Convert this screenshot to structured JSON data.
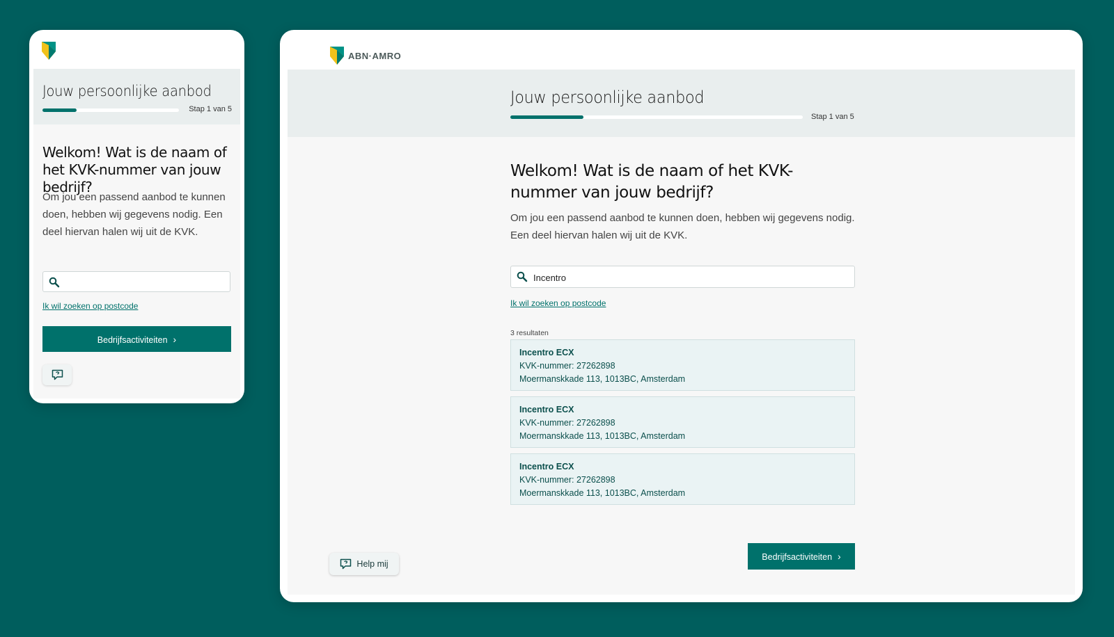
{
  "brand": {
    "name": "ABN·AMRO",
    "colors": {
      "primary": "#00716b",
      "background": "#005e5d",
      "shield_yellow": "#f1c21b",
      "shield_green": "#009286"
    }
  },
  "mobile": {
    "header": {
      "title": "Jouw persoonlijke aanbod",
      "step": "Stap 1 van 5",
      "progress": 0.25
    },
    "heading": "Welkom! Wat is de naam of het KVK-nummer van jouw bedrijf?",
    "intro": "Om jou een passend aanbod te kunnen doen, hebben wij gegevens nodig. Een deel hiervan halen wij uit de KVK.",
    "search": {
      "value": "",
      "icon": "search-icon"
    },
    "postcode_link": "Ik wil zoeken op postcode",
    "next_button": "Bedrijfsactiviteiten",
    "help_icon": "chat-help-icon"
  },
  "desktop": {
    "header": {
      "title": "Jouw persoonlijke aanbod",
      "step": "Stap 1 van 5",
      "progress": 0.25
    },
    "heading": "Welkom! Wat is de naam of het KVK-nummer van jouw bedrijf?",
    "intro": "Om jou een passend aanbod te kunnen doen, hebben wij gegevens nodig. Een deel hiervan halen wij uit de KVK.",
    "search": {
      "value": "Incentro",
      "icon": "search-icon"
    },
    "postcode_link": "Ik wil zoeken op postcode",
    "results_count": "3 resultaten",
    "results": [
      {
        "name": "Incentro ECX",
        "kvk": "KVK-nummer: 27262898",
        "address": "Moermanskkade 113, 1013BC, Amsterdam"
      },
      {
        "name": "Incentro ECX",
        "kvk": "KVK-nummer: 27262898",
        "address": "Moermanskkade 113, 1013BC, Amsterdam"
      },
      {
        "name": "Incentro ECX",
        "kvk": "KVK-nummer: 27262898",
        "address": "Moermanskkade 113, 1013BC, Amsterdam"
      }
    ],
    "next_button": "Bedrijfsactiviteiten",
    "help_button": "Help mij"
  }
}
